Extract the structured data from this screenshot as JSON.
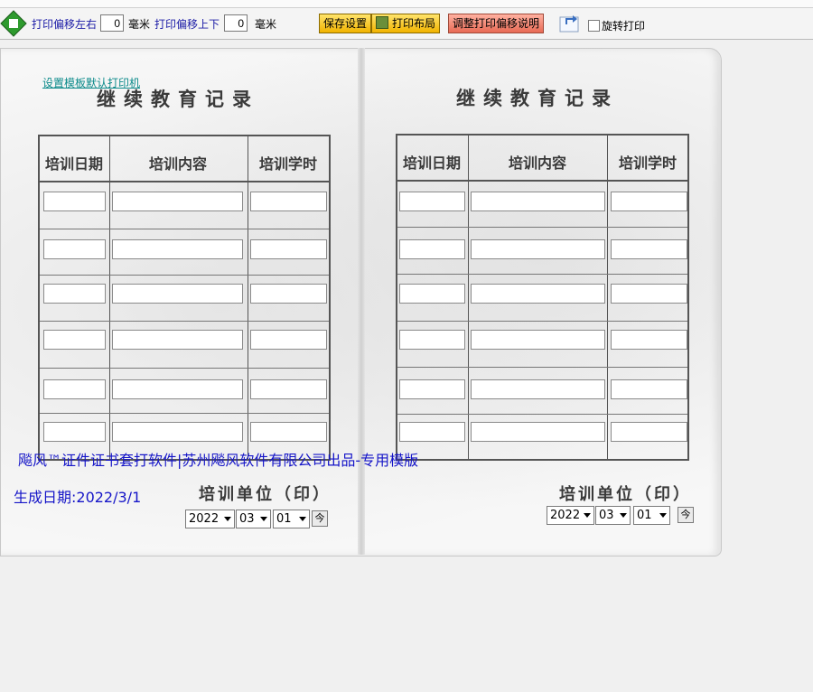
{
  "toolbar": {
    "offset_lr_label": "打印偏移左右",
    "offset_lr_value": "0",
    "unit_mm_1": "毫米",
    "offset_ud_label": "打印偏移上下",
    "offset_ud_value": "0",
    "unit_mm_2": "毫米",
    "save_button": "保存设置",
    "layout_button": "打印布局",
    "adjust_button": "调整打印偏移说明",
    "rotate_label": "旋转打印"
  },
  "link_default_printer": "设置模板默认打印机",
  "left_page": {
    "title": "继续教育记录",
    "col_date": "培训日期",
    "col_content": "培训内容",
    "col_hours": "培训学时",
    "unit_label": "培训单位（印）",
    "year": "2022",
    "month": "03",
    "day": "01",
    "ok": "今"
  },
  "right_page": {
    "title": "继续教育记录",
    "col_date": "培训日期",
    "col_content": "培训内容",
    "col_hours": "培训学时",
    "unit_label": "培训单位（印）",
    "year": "2022",
    "month": "03",
    "day": "01",
    "ok": "今"
  },
  "watermark": "飚风™证件证书套打软件|苏州飚风软件有限公司出品-专用模版",
  "generated": "生成日期:2022/3/1",
  "colors": {
    "accent_blue": "#1515c8",
    "link_teal": "#0b8a8a",
    "button_yellow": "#f1b300",
    "button_red": "#e86a55"
  }
}
